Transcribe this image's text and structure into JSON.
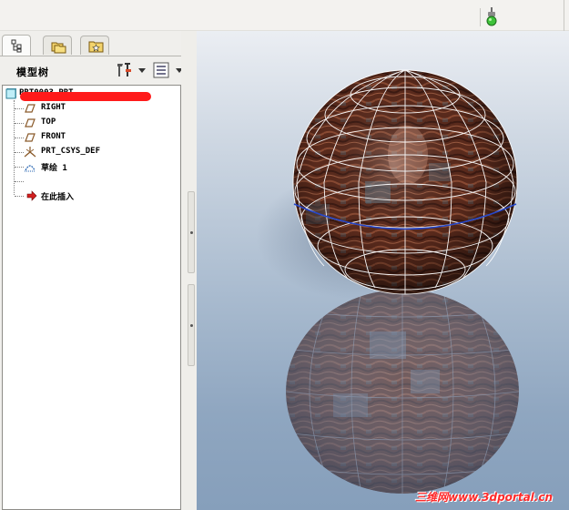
{
  "toolbar": {
    "status_light": "green-status-light-icon"
  },
  "tabs": [
    {
      "icon": "model-tree-icon",
      "active": true
    },
    {
      "icon": "folder-browser-icon",
      "active": false
    },
    {
      "icon": "favorites-icon",
      "active": false
    }
  ],
  "model_tree": {
    "title": "模型树",
    "settings_icon": "tree-settings-icon",
    "show_icon": "tree-show-icon",
    "root": "PRT0003.PRT",
    "items": [
      {
        "label": "RIGHT",
        "icon": "datum-plane-icon"
      },
      {
        "label": "TOP",
        "icon": "datum-plane-icon"
      },
      {
        "label": "FRONT",
        "icon": "datum-plane-icon"
      },
      {
        "label": "PRT_CSYS_DEF",
        "icon": "coordinate-system-icon"
      },
      {
        "label": "草绘 1",
        "icon": "sketch-icon"
      },
      {
        "label": "",
        "icon": "redacted-feature"
      },
      {
        "label": "在此插入",
        "icon": "insert-here-arrow-icon"
      }
    ]
  },
  "colors": {
    "background_top": "#ebeef3",
    "background_bottom": "#869fbb",
    "redaction": "#ff1a1a",
    "watermark": "#ff2a2a"
  },
  "watermark": "三维网www.3dportal.cn"
}
